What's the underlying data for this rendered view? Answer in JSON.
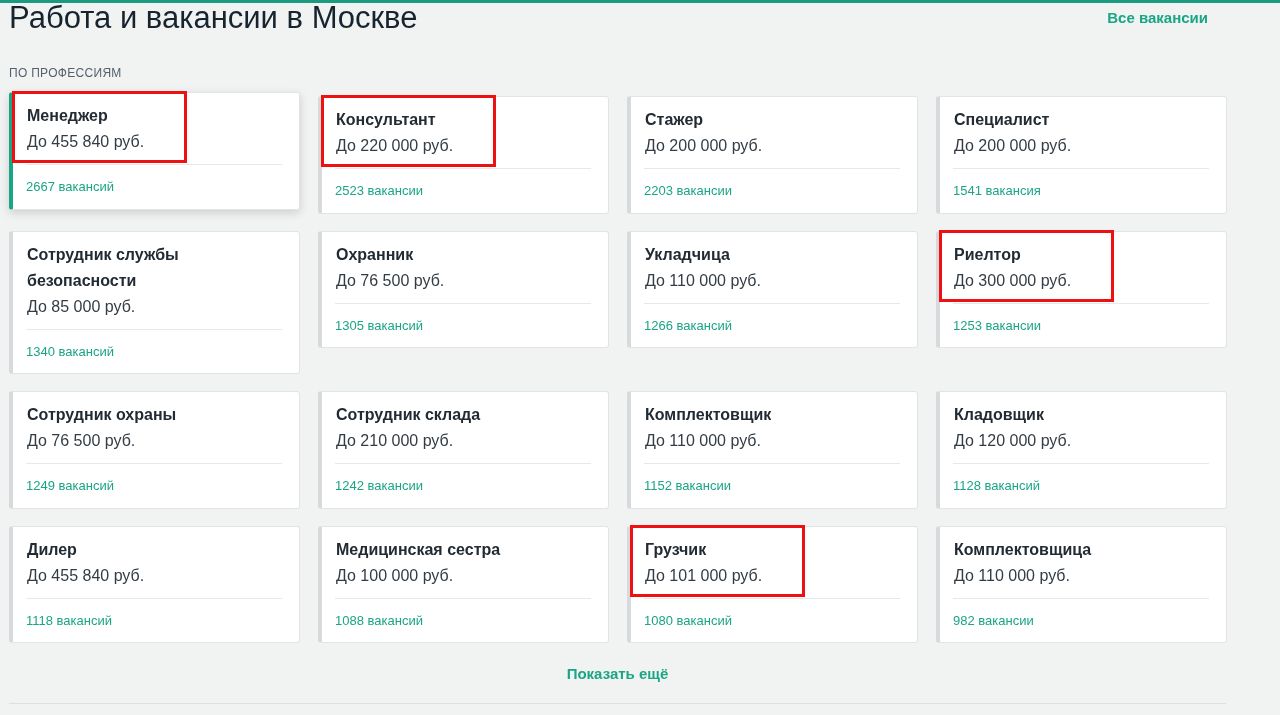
{
  "title": "Работа и вакансии в Москве",
  "all_link": "Все вакансии",
  "section_label": "ПО ПРОФЕССИЯМ",
  "cards": [
    {
      "name": "Менеджер",
      "salary": "До 455 840 руб.",
      "count": "2667 вакансий",
      "selected": true,
      "highlighted": true
    },
    {
      "name": "Консультант",
      "salary": "До 220 000 руб.",
      "count": "2523 вакансии",
      "selected": false,
      "highlighted": true
    },
    {
      "name": "Стажер",
      "salary": "До 200 000 руб.",
      "count": "2203 вакансии",
      "selected": false,
      "highlighted": false
    },
    {
      "name": "Специалист",
      "salary": "До 200 000 руб.",
      "count": "1541 вакансия",
      "selected": false,
      "highlighted": false
    },
    {
      "name": "Сотрудник службы безопасности",
      "salary": "До 85 000 руб.",
      "count": "1340 вакансий",
      "selected": false,
      "highlighted": false
    },
    {
      "name": "Охранник",
      "salary": "До 76 500 руб.",
      "count": "1305 вакансий",
      "selected": false,
      "highlighted": false
    },
    {
      "name": "Укладчица",
      "salary": "До 110 000 руб.",
      "count": "1266 вакансий",
      "selected": false,
      "highlighted": false
    },
    {
      "name": "Риелтор",
      "salary": "До 300 000 руб.",
      "count": "1253 вакансии",
      "selected": false,
      "highlighted": true
    },
    {
      "name": "Сотрудник охраны",
      "salary": "До 76 500 руб.",
      "count": "1249 вакансий",
      "selected": false,
      "highlighted": false
    },
    {
      "name": "Сотрудник склада",
      "salary": "До 210 000 руб.",
      "count": "1242 вакансии",
      "selected": false,
      "highlighted": false
    },
    {
      "name": "Комплектовщик",
      "salary": "До 110 000 руб.",
      "count": "1152 вакансии",
      "selected": false,
      "highlighted": false
    },
    {
      "name": "Кладовщик",
      "salary": "До 120 000 руб.",
      "count": "1128 вакансий",
      "selected": false,
      "highlighted": false
    },
    {
      "name": "Дилер",
      "salary": "До 455 840 руб.",
      "count": "1118 вакансий",
      "selected": false,
      "highlighted": false
    },
    {
      "name": "Медицинская сестра",
      "salary": "До 100 000 руб.",
      "count": "1088 вакансий",
      "selected": false,
      "highlighted": false
    },
    {
      "name": "Грузчик",
      "salary": "До 101 000 руб.",
      "count": "1080 вакансий",
      "selected": false,
      "highlighted": true
    },
    {
      "name": "Комплектовщица",
      "salary": "До 110 000 руб.",
      "count": "982 вакансии",
      "selected": false,
      "highlighted": false
    }
  ],
  "show_more": "Показать ещё"
}
